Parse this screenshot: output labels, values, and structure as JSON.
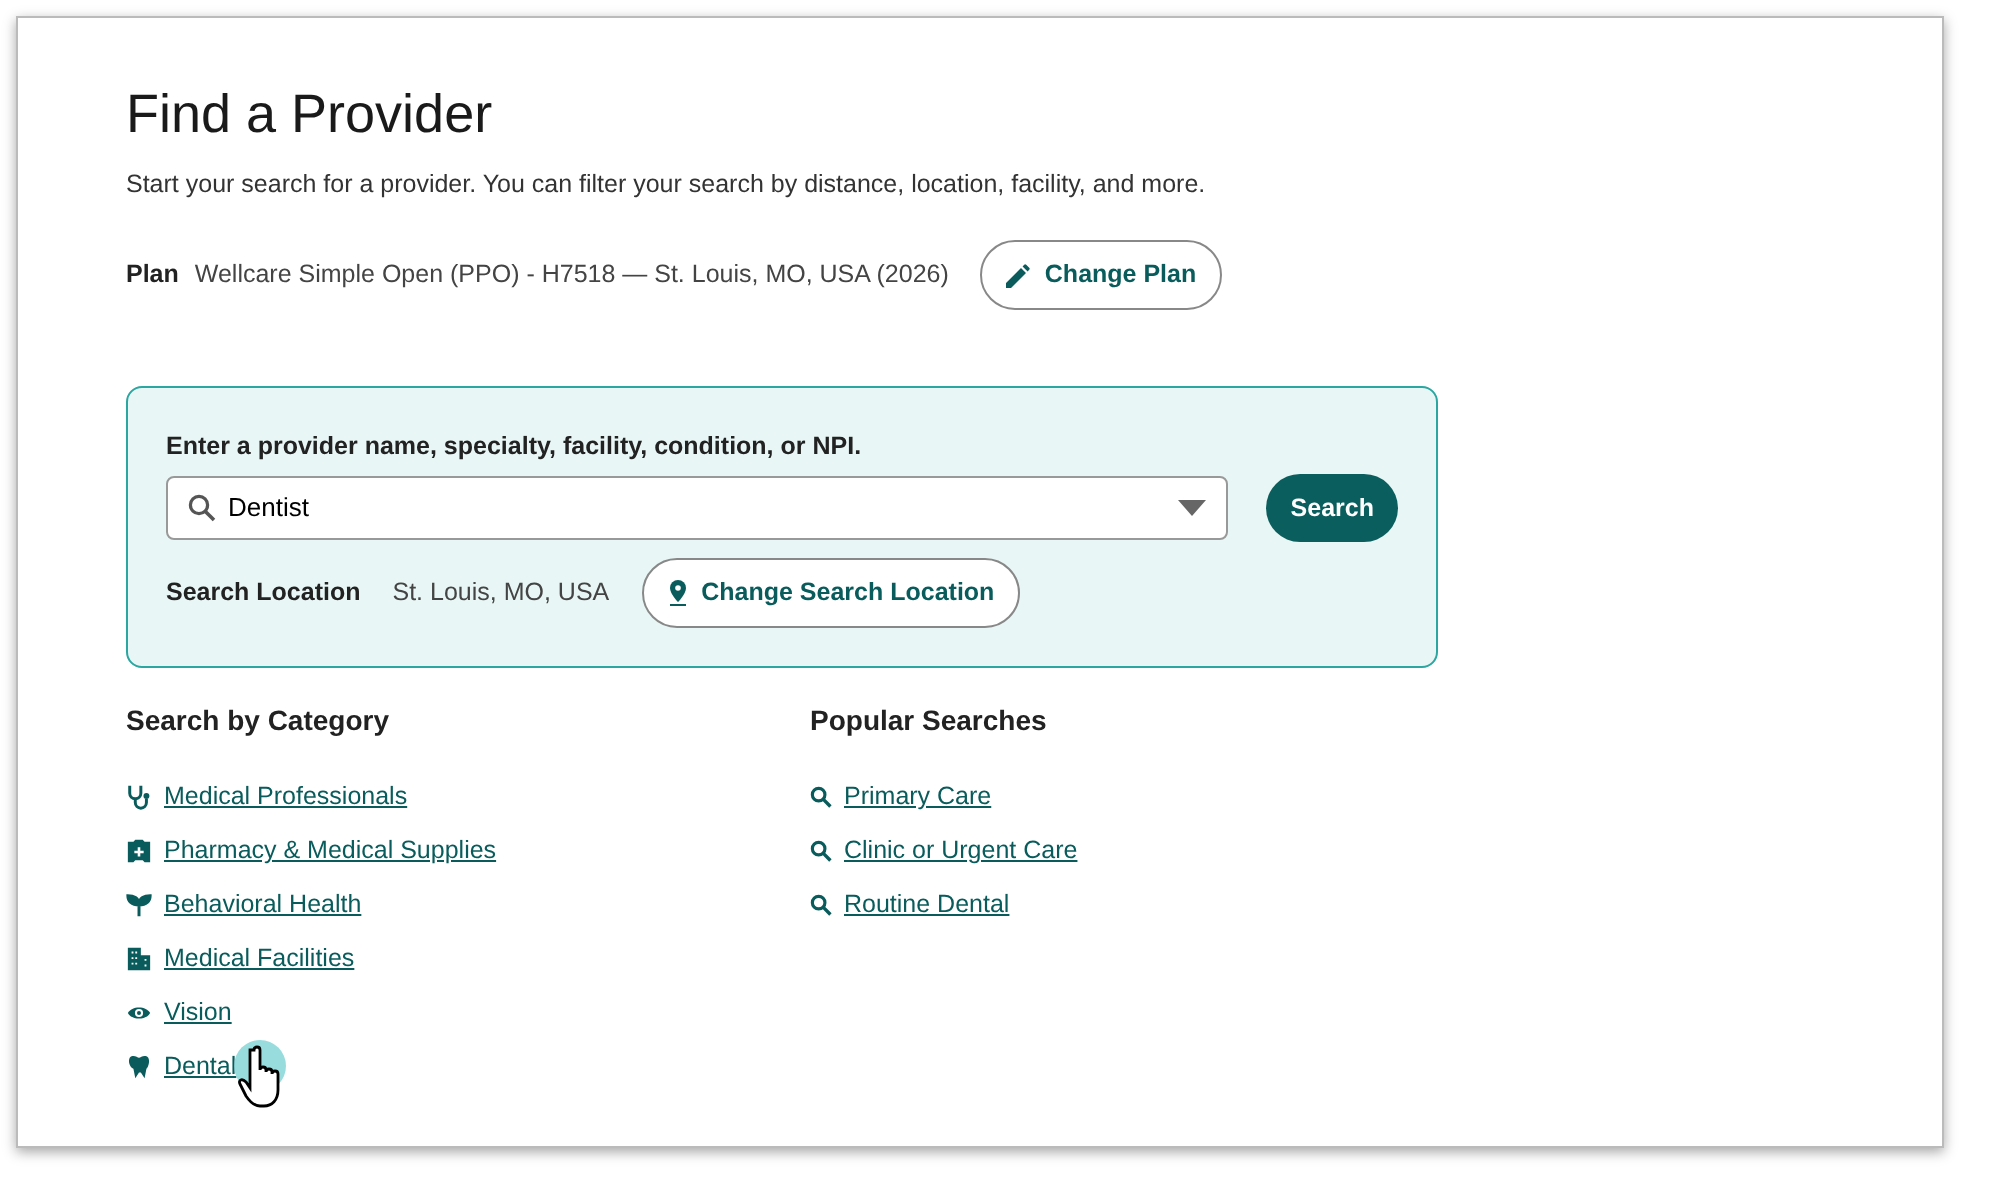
{
  "title": "Find a Provider",
  "subtitle": "Start your search for a provider. You can filter your search by distance, location, facility, and more.",
  "plan": {
    "label": "Plan",
    "value": "Wellcare Simple Open (PPO) - H7518 — St. Louis, MO, USA (2026)",
    "button": "Change Plan"
  },
  "search": {
    "label": "Enter a provider name, specialty, facility, condition, or NPI.",
    "value": "Dentist",
    "button": "Search",
    "location_label": "Search Location",
    "location_value": "St. Louis, MO, USA",
    "location_button": "Change Search Location"
  },
  "categories": {
    "heading": "Search by Category",
    "items": [
      {
        "label": "Medical Professionals",
        "kind": "stethoscope"
      },
      {
        "label": "Pharmacy & Medical Supplies",
        "kind": "pharmacy"
      },
      {
        "label": "Behavioral Health",
        "kind": "sprout"
      },
      {
        "label": "Medical Facilities",
        "kind": "building"
      },
      {
        "label": "Vision",
        "kind": "eye"
      },
      {
        "label": "Dental",
        "kind": "tooth"
      }
    ]
  },
  "popular": {
    "heading": "Popular Searches",
    "items": [
      {
        "label": "Primary Care"
      },
      {
        "label": "Clinic or Urgent Care"
      },
      {
        "label": "Routine Dental"
      }
    ]
  }
}
